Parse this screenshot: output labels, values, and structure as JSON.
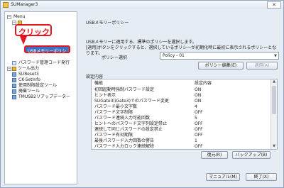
{
  "window": {
    "title": "SUManager3",
    "close_glyph": "✕"
  },
  "callout": {
    "text": "クリック",
    "color": "#e3151f"
  },
  "tree": {
    "items": [
      {
        "label": "Menu",
        "toggle": "−"
      },
      {
        "label": "SUSB ...",
        "toggle": "−"
      },
      {
        "label": "USBメモリーポリシー",
        "selected": true
      },
      {
        "label": "パスワード管理コード発行"
      },
      {
        "label": "ツール出力",
        "toggle": "−"
      },
      {
        "label": "SUReset3"
      },
      {
        "label": "CK-SetInfo"
      },
      {
        "label": "使用制限設定ツール"
      },
      {
        "label": "廃棄ツール"
      },
      {
        "label": "TMUSB2リアップデーター"
      }
    ]
  },
  "panel": {
    "title": "USBメモリーポリシー",
    "desc_line1": "USBメモリーに適用する、標準のポリシーを選択します。",
    "desc_line2": "[適用]ボタンをクリックすると、選択しているポリシーが初期化時に最初に表示されるポリシーとなります。",
    "policy_label": "ポリシー選択",
    "policy_value": "Policy - 01",
    "edit_button": "ポリシー編集(E)",
    "apply_button": "適用(A)",
    "section_label": "設定内容",
    "columns": [
      "機能",
      "設定内容"
    ],
    "rows": [
      [
        "初回起動時強制パスワード設定",
        "ON"
      ],
      [
        "ヒント表示",
        "ON"
      ],
      [
        "SUGate3(iGate3)でのパスワード変更",
        "ON"
      ],
      [
        "パスワード最小文字数",
        "4"
      ],
      [
        "パスワード文字制限",
        "OFF"
      ],
      [
        "パスワード連続入力可能回数",
        "5"
      ],
      [
        "ヒントへのパスワード文字列設定禁止",
        "OFF"
      ],
      [
        "連続して同じパスワードの設定禁止",
        "OFF"
      ],
      [
        "パスワード有効期限",
        "OFF"
      ],
      [
        "最後パスワード入力回数の警告",
        "1"
      ],
      [
        "パスワード入力ロック連続解除",
        "OFF"
      ],
      [
        "マスターパスワード機能",
        "OFF"
      ]
    ],
    "restore_button": "復元(R)",
    "backup_button": "バックアップ(B)"
  },
  "footer": {
    "manual_button": "マニュアル(M)",
    "exit_button": "終了(X)"
  }
}
